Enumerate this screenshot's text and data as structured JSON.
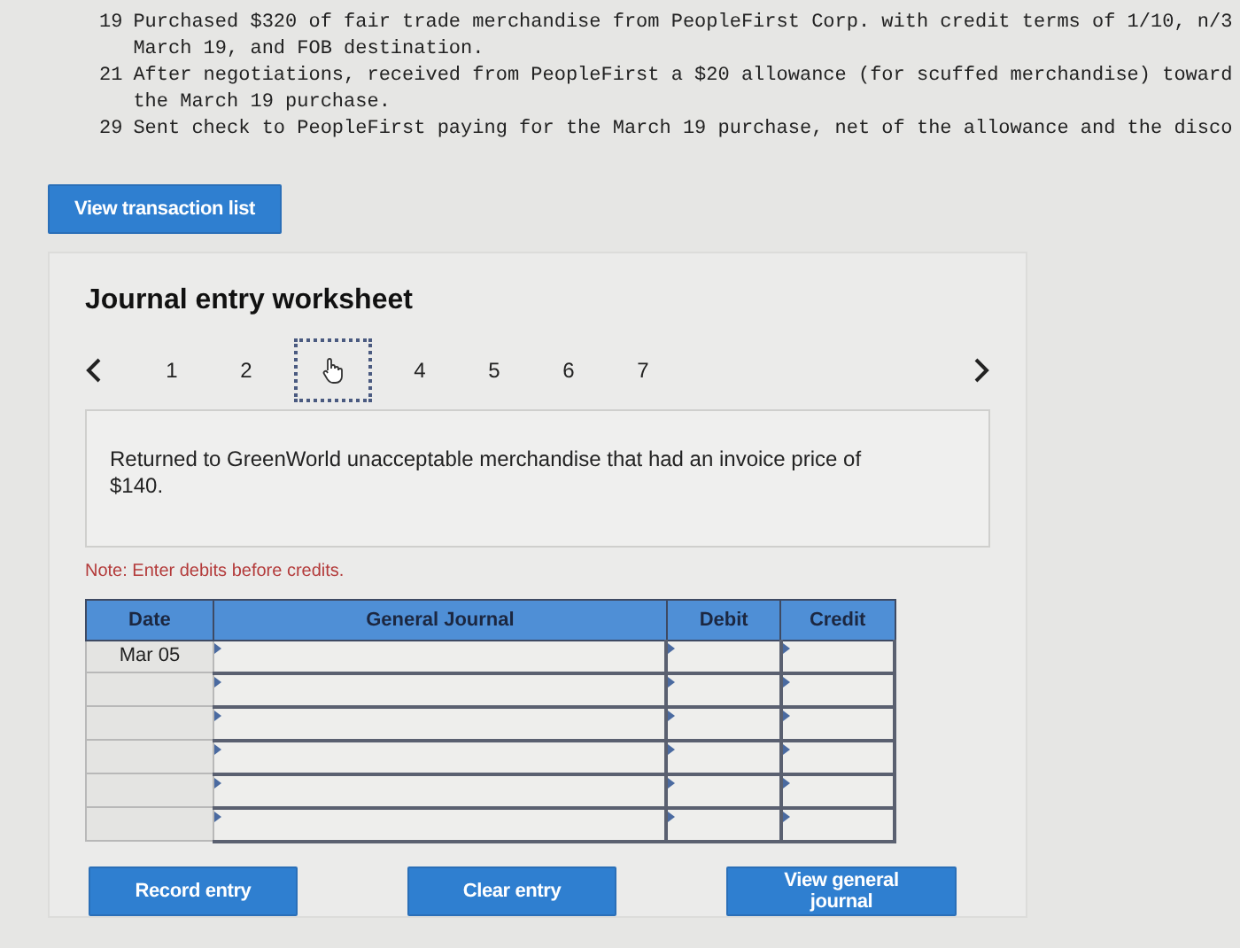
{
  "problem_lines": [
    {
      "day": "19",
      "lines": [
        "Purchased $320 of fair trade merchandise from PeopleFirst Corp. with credit terms of 1/10, n/3",
        "March 19, and FOB destination."
      ]
    },
    {
      "day": "21",
      "lines": [
        "After negotiations, received from PeopleFirst a $20 allowance (for scuffed merchandise) toward",
        "the March 19 purchase."
      ]
    },
    {
      "day": "29",
      "lines": [
        "Sent check to PeopleFirst paying for the March 19 purchase, net of the allowance and the disco"
      ]
    }
  ],
  "transaction_button": "View transaction list",
  "worksheet": {
    "title": "Journal entry worksheet",
    "steps": [
      {
        "label": "1",
        "selected": false
      },
      {
        "label": "2",
        "selected": false
      },
      {
        "selected": true
      },
      {
        "label": "4",
        "selected": false
      },
      {
        "label": "5",
        "selected": false
      },
      {
        "label": "6",
        "selected": false
      },
      {
        "label": "7",
        "selected": false
      }
    ],
    "description": "Returned to GreenWorld unacceptable merchandise that had an invoice price of $140.",
    "note": "Note: Enter debits before credits.",
    "table": {
      "columns": [
        "Date",
        "General Journal",
        "Debit",
        "Credit"
      ],
      "rows": [
        {
          "date": "Mar 05"
        },
        {},
        {},
        {},
        {},
        {}
      ]
    },
    "buttons": [
      "Record entry",
      "Clear entry",
      "View general journal"
    ]
  }
}
